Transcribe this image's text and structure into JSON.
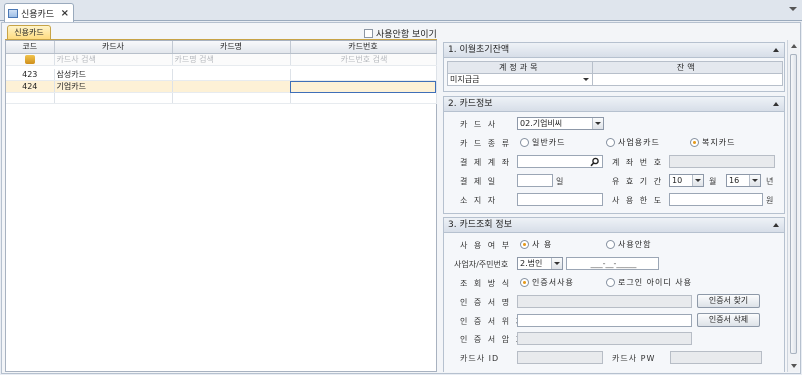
{
  "tab": {
    "title": "신용카드",
    "close": "×"
  },
  "subtab": "신용카드",
  "show_unused_label": "사용안함 보이기",
  "grid": {
    "columns": [
      "코드",
      "카드사",
      "카드명",
      "카드번호"
    ],
    "filter_placeholders": [
      "카드사 검색",
      "카드명 검색",
      "카드번호 검색"
    ],
    "rows": [
      {
        "code": "423",
        "company": "삼성카드",
        "name": "",
        "number": ""
      },
      {
        "code": "424",
        "company": "기업카드",
        "name": "",
        "number": ""
      }
    ]
  },
  "section1": {
    "title": "1. 이월초기잔액",
    "columns": [
      "계정과목",
      "잔액"
    ],
    "account_value": "미지급금",
    "balance_value": ""
  },
  "section2": {
    "title": "2. 카드정보",
    "card_company_label": "카 드 사",
    "card_company_value": "02.기업비씨",
    "card_type_label": "카 드 종 류",
    "card_type_options": [
      "일반카드",
      "사업용카드",
      "복지카드"
    ],
    "card_type_selected": "복지카드",
    "payment_account_label": "결 제 계 좌",
    "account_no_label": "계 좌 번 호",
    "payment_day_label": "결 제 일",
    "day_suffix": "일",
    "validity_label": "유 효 기 간",
    "validity_month": "10",
    "month_suffix": "월",
    "validity_year": "16",
    "year_suffix": "년",
    "holder_label": "소 지 자",
    "limit_label": "사 용 한 도",
    "won_suffix": "원"
  },
  "section3": {
    "title": "3. 카드조회 정보",
    "use_label": "사 용 여 부",
    "use_options": [
      "사 용",
      "사용안함"
    ],
    "use_selected": "사 용",
    "biz_label": "사업자/주민번호",
    "biz_type": "2.법인",
    "biz_mask": "___-__-_____",
    "method_label": "조 회 방 식",
    "method_options": [
      "인증서사용",
      "로그인 아이디 사용"
    ],
    "method_selected": "인증서사용",
    "cert_name_label": "인 증 서 명",
    "cert_find_button": "인증서 찾기",
    "cert_loc_label": "인 증 서 위 치",
    "cert_delete_button": "인증서 삭제",
    "cert_pw_label": "인 증 서 암 호",
    "card_id_label": "카드사 ID",
    "card_pw_label": "카드사 PW"
  }
}
